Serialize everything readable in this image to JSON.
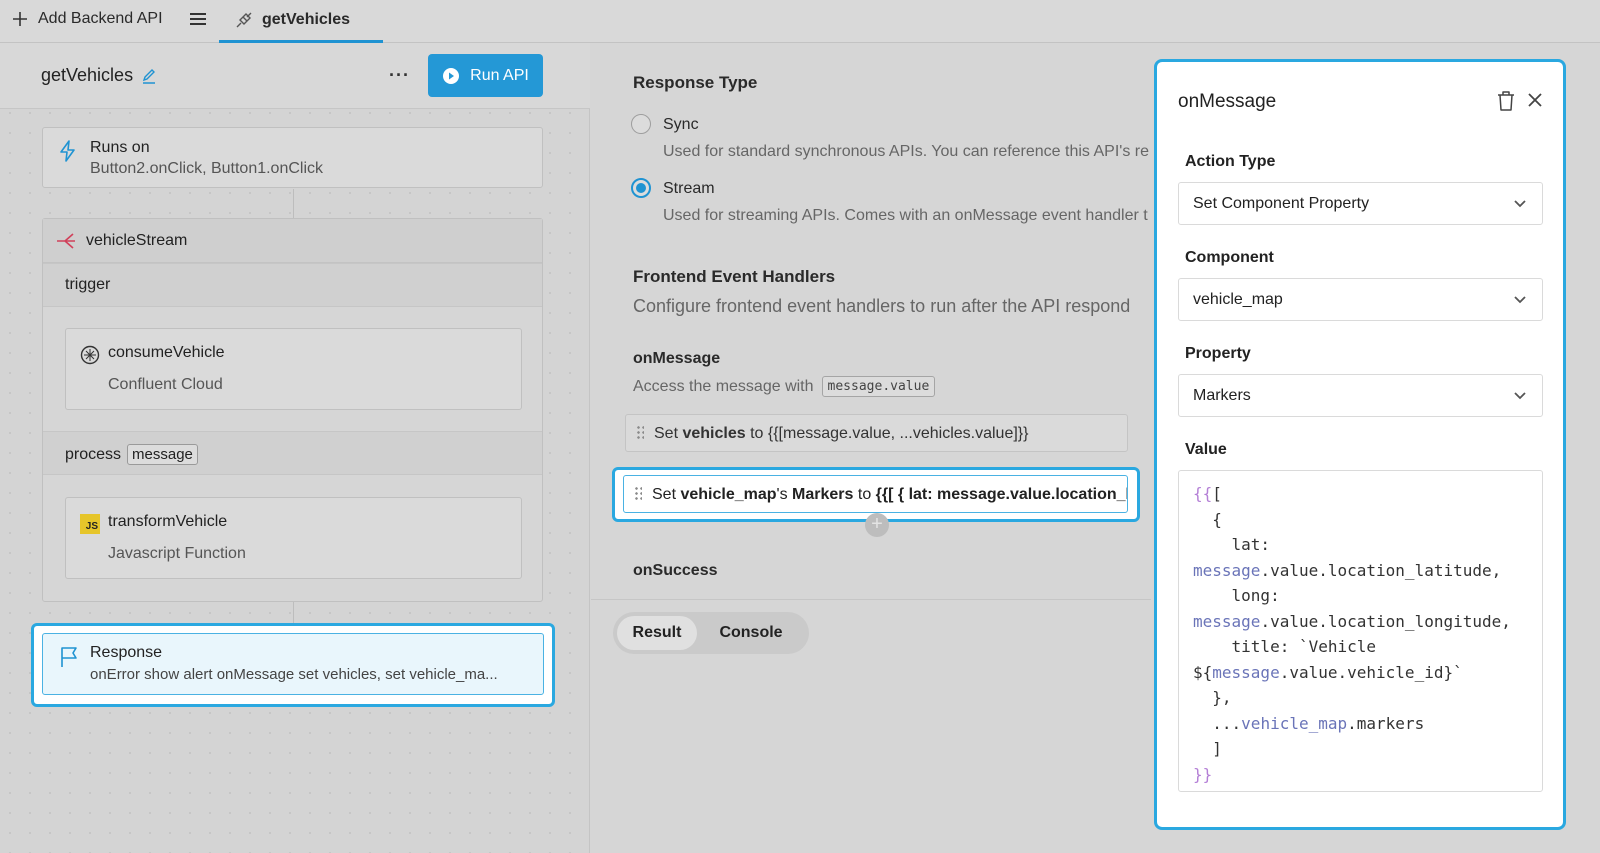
{
  "topbar": {
    "add_label": "Add Backend API",
    "active_tab": "getVehicles"
  },
  "left": {
    "api_name": "getVehicles",
    "run_label": "Run API",
    "runs_on": {
      "title": "Runs on",
      "subtitle": "Button2.onClick, Button1.onClick"
    },
    "stream": {
      "title": "vehicleStream",
      "trigger_label": "trigger",
      "trigger_step": {
        "title": "consumeVehicle",
        "subtitle": "Confluent Cloud"
      },
      "process_label": "process",
      "process_chip": "message",
      "process_step": {
        "title": "transformVehicle",
        "subtitle": "Javascript Function",
        "badge": "JS"
      }
    },
    "response": {
      "title": "Response",
      "subtitle": "onError show alert onMessage set vehicles, set vehicle_ma..."
    }
  },
  "mid": {
    "response_type_label": "Response Type",
    "sync_label": "Sync",
    "sync_desc": "Used for standard synchronous APIs. You can reference this API's re",
    "stream_label": "Stream",
    "stream_desc": "Used for streaming APIs. Comes with an onMessage event handler t",
    "feh_label": "Frontend Event Handlers",
    "feh_desc": "Configure frontend event handlers to run after the API respond",
    "onmessage_label": "onMessage",
    "onmessage_access": "Access the message with",
    "onmessage_code": "message.value",
    "handler1": {
      "pre": "Set",
      "bold": "vehicles",
      "post": "to {{[message.value, ...vehicles.value]}}"
    },
    "handler2": {
      "pre": "Set",
      "bold": "vehicle_map",
      "mid1": "'s",
      "bold2": "Markers",
      "mid2": "to",
      "bold3": "{{[ { lat: message.value.location_l..."
    },
    "onsuccess_label": "onSuccess",
    "tab_result": "Result",
    "tab_console": "Console"
  },
  "modal": {
    "title": "onMessage",
    "action_type_label": "Action Type",
    "action_type_value": "Set Component Property",
    "component_label": "Component",
    "component_value": "vehicle_map",
    "property_label": "Property",
    "property_value": "Markers",
    "value_label": "Value",
    "code_lines": [
      "{{[",
      "  {",
      "    lat:",
      "message.value.location_latitude,",
      "    long:",
      "message.value.location_longitude,",
      "    title: `Vehicle",
      "${message.value.vehicle_id}`",
      "  },",
      "  ...vehicle_map.markers",
      "  ]",
      "}}"
    ]
  },
  "colors": {
    "accent": "#1f93d2",
    "highlight": "#2aa8e0",
    "run_button": "#2498d6"
  }
}
